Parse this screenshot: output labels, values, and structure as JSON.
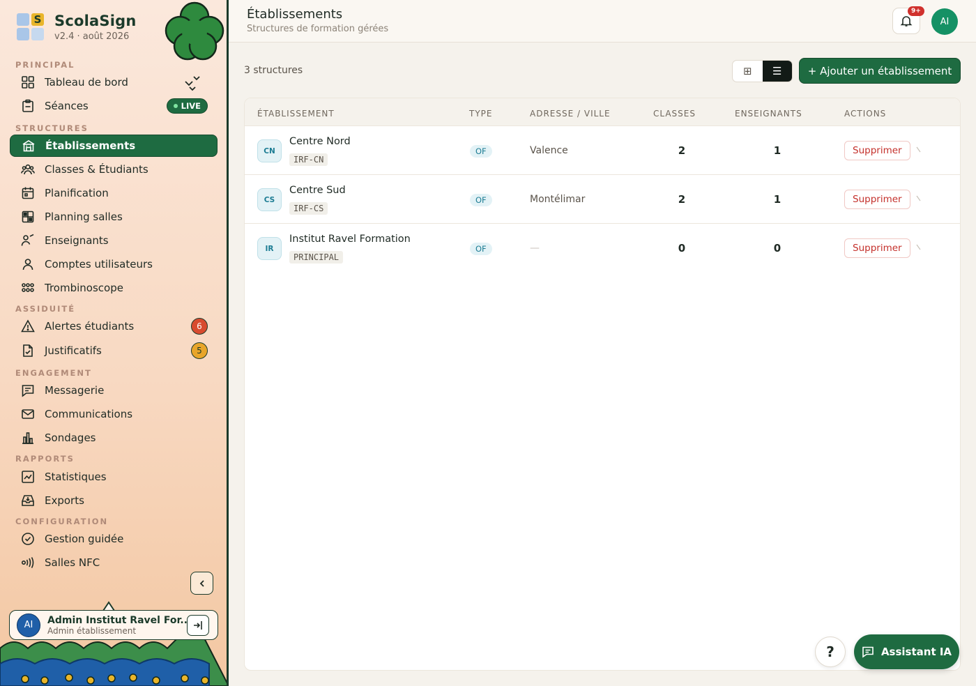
{
  "app": {
    "name": "ScolaSign",
    "version": "v2.4 · août 2026",
    "logo_letter": "S"
  },
  "sidebar": {
    "sections": [
      {
        "label": "PRINCIPAL"
      },
      {
        "label": "STRUCTURES"
      },
      {
        "label": "ASSIDUITÉ"
      },
      {
        "label": "ENGAGEMENT"
      },
      {
        "label": "RAPPORTS"
      },
      {
        "label": "CONFIGURATION"
      }
    ],
    "items": [
      {
        "label": "Tableau de bord",
        "icon": "grid-icon"
      },
      {
        "label": "Séances",
        "icon": "clipboard-icon",
        "live": "LIVE"
      },
      {
        "label": "Établissements",
        "icon": "building-icon",
        "active": true
      },
      {
        "label": "Classes & Étudiants",
        "icon": "users-icon"
      },
      {
        "label": "Planification",
        "icon": "calendar-icon"
      },
      {
        "label": "Planning salles",
        "icon": "rooms-icon"
      },
      {
        "label": "Enseignants",
        "icon": "teacher-icon"
      },
      {
        "label": "Comptes utilisateurs",
        "icon": "user-icon"
      },
      {
        "label": "Trombinoscope",
        "icon": "faces-grid-icon"
      },
      {
        "label": "Alertes étudiants",
        "icon": "warning-icon",
        "badge": "6"
      },
      {
        "label": "Justificatifs",
        "icon": "document-check-icon",
        "badge": "5"
      },
      {
        "label": "Messagerie",
        "icon": "message-icon"
      },
      {
        "label": "Communications",
        "icon": "mail-icon"
      },
      {
        "label": "Sondages",
        "icon": "bar-chart-icon"
      },
      {
        "label": "Statistiques",
        "icon": "line-chart-icon"
      },
      {
        "label": "Exports",
        "icon": "inbox-icon"
      },
      {
        "label": "Gestion guidée",
        "icon": "check-circle-icon"
      },
      {
        "label": "Salles NFC",
        "icon": "nfc-icon"
      }
    ],
    "profile": {
      "initials": "AI",
      "name": "Admin Institut Ravel For...",
      "role": "Admin établissement"
    }
  },
  "header": {
    "title": "Établissements",
    "subtitle": "Structures de formation gérées",
    "notif_count": "9+",
    "avatar_initials": "AI"
  },
  "toolbar": {
    "count_label": "3 structures",
    "grid_icon": "⊞",
    "list_icon": "☰",
    "add_label": "+ Ajouter un établissement"
  },
  "table": {
    "columns": [
      "ÉTABLISSEMENT",
      "TYPE",
      "ADRESSE / VILLE",
      "CLASSES",
      "ENSEIGNANTS",
      "ACTIONS"
    ],
    "rows": [
      {
        "initials": "CN",
        "name": "Centre Nord",
        "code": "IRF-CN",
        "type": "OF",
        "address": "Valence",
        "classes": "2",
        "teachers": "1",
        "action": "Supprimer"
      },
      {
        "initials": "CS",
        "name": "Centre Sud",
        "code": "IRF-CS",
        "type": "OF",
        "address": "Montélimar",
        "classes": "2",
        "teachers": "1",
        "action": "Supprimer"
      },
      {
        "initials": "IR",
        "name": "Institut Ravel Formation",
        "code": "PRINCIPAL",
        "type": "OF",
        "address": "—",
        "classes": "0",
        "teachers": "0",
        "action": "Supprimer"
      }
    ]
  },
  "floating": {
    "help_label": "?",
    "assistant_label": "Assistant IA"
  },
  "colors": {
    "primary": "#1e6b41",
    "danger": "#c4302b",
    "accent_blue": "#1c7c93"
  }
}
